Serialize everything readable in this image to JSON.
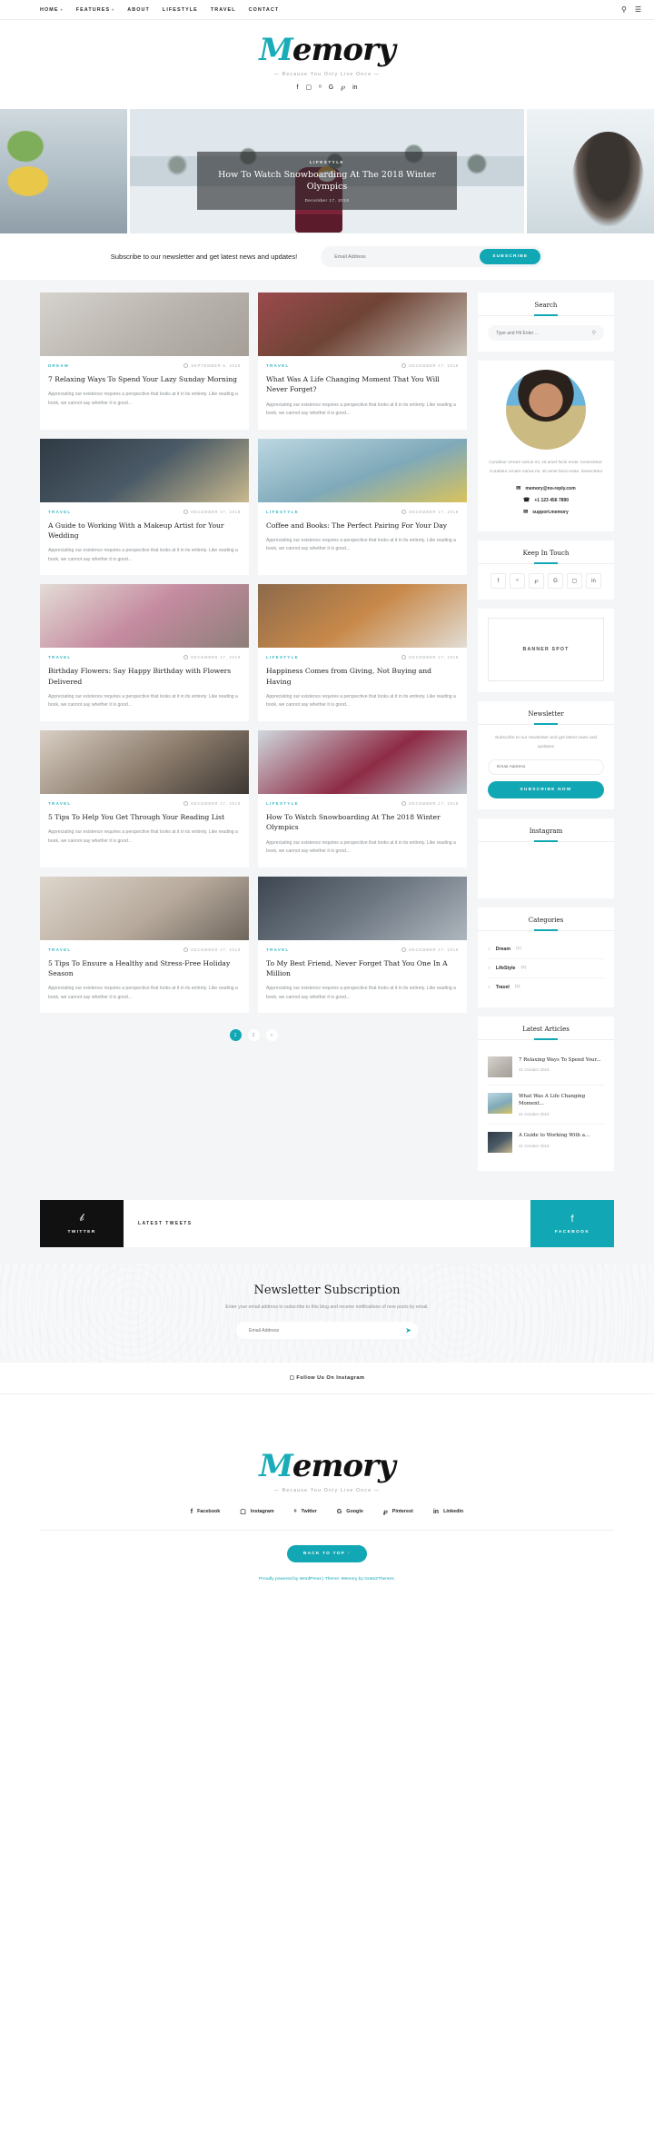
{
  "nav": {
    "items": [
      {
        "label": "HOME",
        "has_caret": true
      },
      {
        "label": "FEATURES",
        "has_caret": true
      },
      {
        "label": "ABOUT",
        "has_caret": false
      },
      {
        "label": "LIFESTYLE",
        "has_caret": false
      },
      {
        "label": "TRAVEL",
        "has_caret": false
      },
      {
        "label": "CONTACT",
        "has_caret": false
      }
    ],
    "search_icon": "search-icon",
    "menu_icon": "hamburger-menu-icon"
  },
  "brand": {
    "logo_primary": "M",
    "logo_rest": "emory",
    "tagline": "—  Because You Only Live Once  —",
    "social": [
      "facebook-icon",
      "instagram-icon",
      "twitter-icon",
      "google-plus-icon",
      "pinterest-icon",
      "linkedin-icon"
    ],
    "social_glyphs": [
      "f",
      "▢",
      "ᵒ",
      "G",
      "℘",
      "in"
    ]
  },
  "hero": {
    "category": "LIFESTYLE",
    "title": "How To Watch Snowboarding At The 2018 Winter Olympics",
    "date": "December 17, 2018"
  },
  "subscribe_bar": {
    "text": "Subscribe to our newsletter and get latest news and updates!",
    "placeholder": "Email Address",
    "button": "SUBSCRIBE"
  },
  "posts": [
    {
      "category": "DREAM",
      "date": "SEPTEMBER 8, 2020",
      "title": "7 Relaxing Ways To Spend Your Lazy Sunday Morning",
      "excerpt": "Appreciating our existence requires a perspective that looks at it in its entirety. Like reading a book, we cannot say whether it is good...",
      "img": "i1"
    },
    {
      "category": "TRAVEL",
      "date": "DECEMBER 17, 2018",
      "title": "What Was A Life Changing Moment That You Will Never Forget?",
      "excerpt": "Appreciating our existence requires a perspective that looks at it in its entirety. Like reading a book, we cannot say whether it is good...",
      "img": "i2"
    },
    {
      "category": "TRAVEL",
      "date": "DECEMBER 17, 2018",
      "title": "A Guide to Working With a Makeup Artist for Your Wedding",
      "excerpt": "Appreciating our existence requires a perspective that looks at it in its entirety. Like reading a book, we cannot say whether it is good...",
      "img": "i3"
    },
    {
      "category": "LIFESTYLE",
      "date": "DECEMBER 17, 2018",
      "title": "Coffee and Books: The Perfect Pairing For Your Day",
      "excerpt": "Appreciating our existence requires a perspective that looks at it in its entirety. Like reading a book, we cannot say whether it is good...",
      "img": "i4"
    },
    {
      "category": "TRAVEL",
      "date": "DECEMBER 17, 2018",
      "title": "Birthday Flowers: Say Happy Birthday with Flowers Delivered",
      "excerpt": "Appreciating our existence requires a perspective that looks at it in its entirety. Like reading a book, we cannot say whether it is good...",
      "img": "i5"
    },
    {
      "category": "LIFESTYLE",
      "date": "DECEMBER 17, 2018",
      "title": "Happiness Comes from Giving, Not Buying and Having",
      "excerpt": "Appreciating our existence requires a perspective that looks at it in its entirety. Like reading a book, we cannot say whether it is good...",
      "img": "i6"
    },
    {
      "category": "TRAVEL",
      "date": "DECEMBER 17, 2018",
      "title": "5 Tips To Help You Get Through Your Reading List",
      "excerpt": "Appreciating our existence requires a perspective that looks at it in its entirety. Like reading a book, we cannot say whether it is good...",
      "img": "i7"
    },
    {
      "category": "LIFESTYLE",
      "date": "DECEMBER 17, 2018",
      "title": "How To Watch Snowboarding At The 2018 Winter Olympics",
      "excerpt": "Appreciating our existence requires a perspective that looks at it in its entirety. Like reading a book, we cannot say whether it is good...",
      "img": "i8"
    },
    {
      "category": "TRAVEL",
      "date": "DECEMBER 17, 2018",
      "title": "5 Tips To Ensure a Healthy and Stress-Free Holiday Season",
      "excerpt": "Appreciating our existence requires a perspective that looks at it in its entirety. Like reading a book, we cannot say whether it is good...",
      "img": "i9"
    },
    {
      "category": "TRAVEL",
      "date": "DECEMBER 17, 2018",
      "title": "To My Best Friend, Never Forget That You One In A Million",
      "excerpt": "Appreciating our existence requires a perspective that looks at it in its entirety. Like reading a book, we cannot say whether it is good...",
      "img": "i10"
    }
  ],
  "pagination": {
    "pages": [
      "1",
      "2",
      "»"
    ],
    "current": "1"
  },
  "sidebar": {
    "search": {
      "title": "Search",
      "placeholder": "Type and Hit Enter ...",
      "icon": "search-icon"
    },
    "about": {
      "text": "Curabitur ornare varius mi, sit amet facis erate. lonsectetur. Curabitur ornare varius mi, sit amet facis erate. lonsectetur",
      "email": "memory@no-reply.com",
      "phone": "+1 123 456 7890",
      "support": "support.memory",
      "email_icon": "envelope-icon",
      "phone_icon": "phone-icon",
      "support_icon": "message-icon"
    },
    "keep_in_touch": {
      "title": "Keep In Touch",
      "icons": [
        "facebook-icon",
        "twitter-icon",
        "pinterest-icon",
        "google-plus-icon",
        "instagram-icon",
        "linkedin-icon"
      ],
      "glyphs": [
        "f",
        "ᵒ",
        "℘",
        "G",
        "▢",
        "in"
      ]
    },
    "banner": {
      "label": "BANNER SPOT"
    },
    "newsletter": {
      "title": "Newsletter",
      "text": "Subscribe to our newsletter and get latest news and updates!",
      "placeholder": "Email Address",
      "button": "SUBSCRIBE NOW"
    },
    "instagram": {
      "title": "Instagram"
    },
    "categories": {
      "title": "Categories",
      "items": [
        {
          "name": "Dream",
          "count": "(2)"
        },
        {
          "name": "LifeStyle",
          "count": "(6)"
        },
        {
          "name": "Travel",
          "count": "(6)"
        }
      ]
    },
    "latest_articles": {
      "title": "Latest Articles",
      "items": [
        {
          "title": "7 Relaxing Ways To Spend Your...",
          "date": "31 October 2018",
          "img": "i1"
        },
        {
          "title": "What Was A Life Changing Moment...",
          "date": "31 October 2018",
          "img": "i4"
        },
        {
          "title": "A Guide to Working With a...",
          "date": "31 October 2018",
          "img": "i3"
        }
      ]
    }
  },
  "social_strip": {
    "twitter_label": "TWITTER",
    "twitter_icon": "twitter-icon",
    "middle_label": "LATEST TWEETS",
    "facebook_label": "FACEBOOK",
    "facebook_icon": "facebook-icon"
  },
  "newsletter_section": {
    "heading": "Newsletter Subscription",
    "subtext": "Enter your email address to subscribe to this blog and receive notifications of new posts by email.",
    "placeholder": "Email Address",
    "send_icon": "send-icon"
  },
  "instagram_bar": {
    "label": "Follow Us On Instagram",
    "icon": "instagram-icon"
  },
  "footer": {
    "logo_primary": "M",
    "logo_rest": "emory",
    "tagline": "—  Because You Only Live Once  —",
    "social": [
      {
        "label": "Facebook",
        "glyph": "f",
        "icon": "facebook-icon"
      },
      {
        "label": "Instagram",
        "glyph": "▢",
        "icon": "instagram-icon"
      },
      {
        "label": "Twitter",
        "glyph": "ᵒ",
        "icon": "twitter-icon"
      },
      {
        "label": "Google",
        "glyph": "G",
        "icon": "google-plus-icon"
      },
      {
        "label": "Pinterest",
        "glyph": "℘",
        "icon": "pinterest-icon"
      },
      {
        "label": "Linkedin",
        "glyph": "in",
        "icon": "linkedin-icon"
      }
    ],
    "back_to_top": "BACK TO TOP ↑",
    "copyright": "Proudly powered by WordPress | Theme: Memory by Grats2Themes."
  },
  "colors": {
    "accent": "#12a7b4",
    "dark": "#111111",
    "muted": "#8b9196"
  }
}
